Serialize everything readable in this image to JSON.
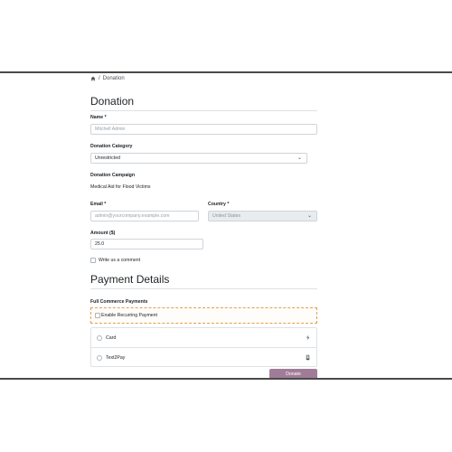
{
  "breadcrumb": {
    "separator": "/",
    "current": "Donation"
  },
  "form": {
    "title": "Donation",
    "name": {
      "label": "Name *",
      "placeholder": "Mitchell Admin"
    },
    "category": {
      "label": "Donation Category",
      "value": "Unrestricted"
    },
    "campaign": {
      "label": "Donation Campaign",
      "value": "Medical Aid for Flood Victims"
    },
    "email": {
      "label": "Email *",
      "placeholder": "admin@yourcompany.example.com"
    },
    "country": {
      "label": "Country *",
      "value": "United States"
    },
    "amount": {
      "label": "Amount ($)",
      "value": "25.0"
    },
    "comment": {
      "label": "Write us a comment"
    }
  },
  "payment": {
    "title": "Payment Details",
    "section_label": "Full Commerce Payments",
    "recurring_label": "Enable Recurring Payment",
    "methods": [
      {
        "label": "Card",
        "icon": "stripe-icon"
      },
      {
        "label": "Text2Pay",
        "icon": "phone-icon"
      }
    ],
    "submit_label": "Donate"
  },
  "colors": {
    "accent": "#a17c98",
    "recurring_border": "#e0a052",
    "rule": "#4a4a4a"
  }
}
